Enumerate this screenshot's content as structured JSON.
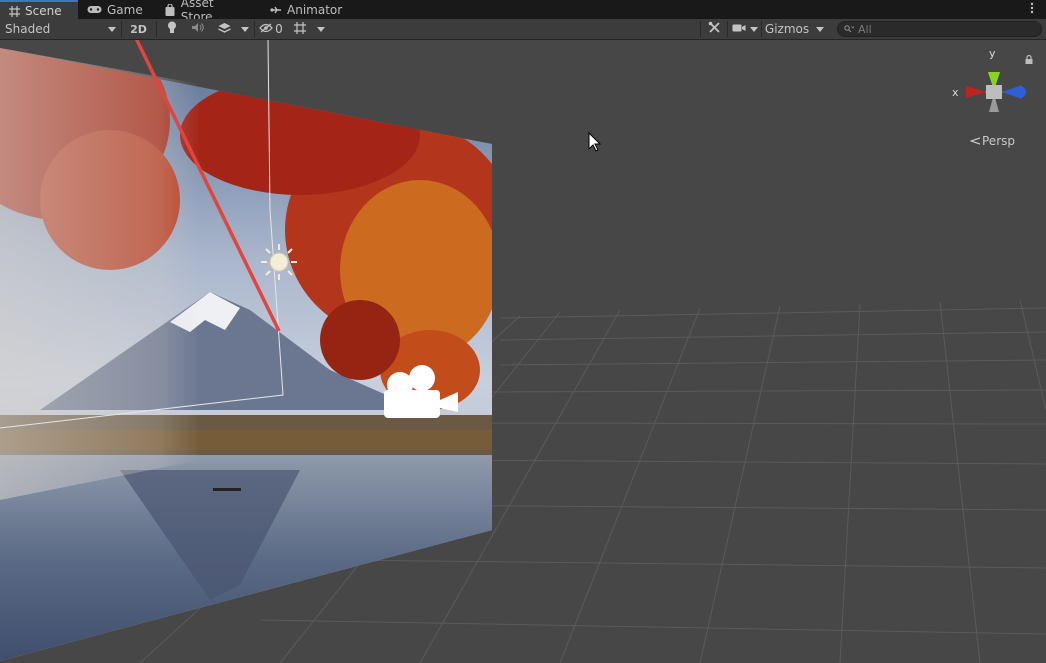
{
  "tabs": [
    {
      "label": "Scene",
      "icon": "grid-icon",
      "active": true
    },
    {
      "label": "Game",
      "icon": "gamepad-icon",
      "active": false
    },
    {
      "label": "Asset Store",
      "icon": "shopping-bag-icon",
      "active": false
    },
    {
      "label": "Animator",
      "icon": "animator-icon",
      "active": false
    }
  ],
  "toolbar": {
    "shading_mode": "Shaded",
    "mode_2d_label": "2D",
    "hidden_count": "0",
    "gizmos_label": "Gizmos",
    "search_placeholder": "All"
  },
  "viewport": {
    "projection_label": "Persp",
    "axes": {
      "x": "x",
      "y": "y"
    },
    "colors": {
      "x_axis": "#c0221d",
      "y_axis": "#8ad421",
      "z_axis": "#2f5fd8",
      "annotation_arrow": "#e2443e",
      "background": "#474747"
    }
  }
}
